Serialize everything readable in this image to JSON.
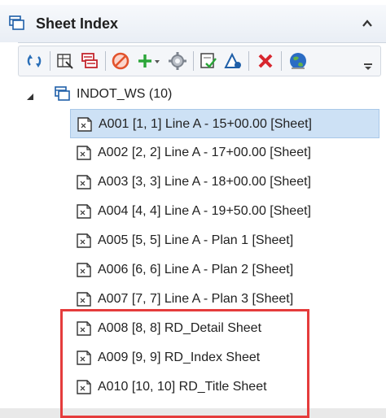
{
  "header": {
    "title": "Sheet Index"
  },
  "toolbar": {
    "buttons": [
      "refresh-icon",
      "open-sheet-icon",
      "sheet-properties-icon",
      "disable-icon",
      "add-icon",
      "settings-icon",
      "check-icon",
      "design-icon",
      "delete-icon",
      "globe-icon",
      "overflow-icon"
    ]
  },
  "tree": {
    "root": {
      "label": "INDOT_WS (10)"
    },
    "items": [
      {
        "label": "A001 [1, 1] Line A - 15+00.00 [Sheet]",
        "selected": true
      },
      {
        "label": "A002 [2, 2] Line A - 17+00.00 [Sheet]",
        "selected": false
      },
      {
        "label": "A003 [3, 3] Line A - 18+00.00 [Sheet]",
        "selected": false
      },
      {
        "label": "A004 [4, 4] Line A - 19+50.00 [Sheet]",
        "selected": false
      },
      {
        "label": "A005 [5, 5] Line A - Plan 1 [Sheet]",
        "selected": false
      },
      {
        "label": "A006 [6, 6] Line A - Plan 2 [Sheet]",
        "selected": false
      },
      {
        "label": "A007 [7, 7] Line A - Plan 3 [Sheet]",
        "selected": false
      },
      {
        "label": "A008 [8, 8] RD_Detail Sheet",
        "selected": false
      },
      {
        "label": "A009 [9, 9] RD_Index Sheet",
        "selected": false
      },
      {
        "label": "A010 [10, 10] RD_Title Sheet",
        "selected": false
      }
    ]
  },
  "colors": {
    "selection": "#cde1f5",
    "highlight": "#e53c3c",
    "accent": "#1f5fa8"
  }
}
